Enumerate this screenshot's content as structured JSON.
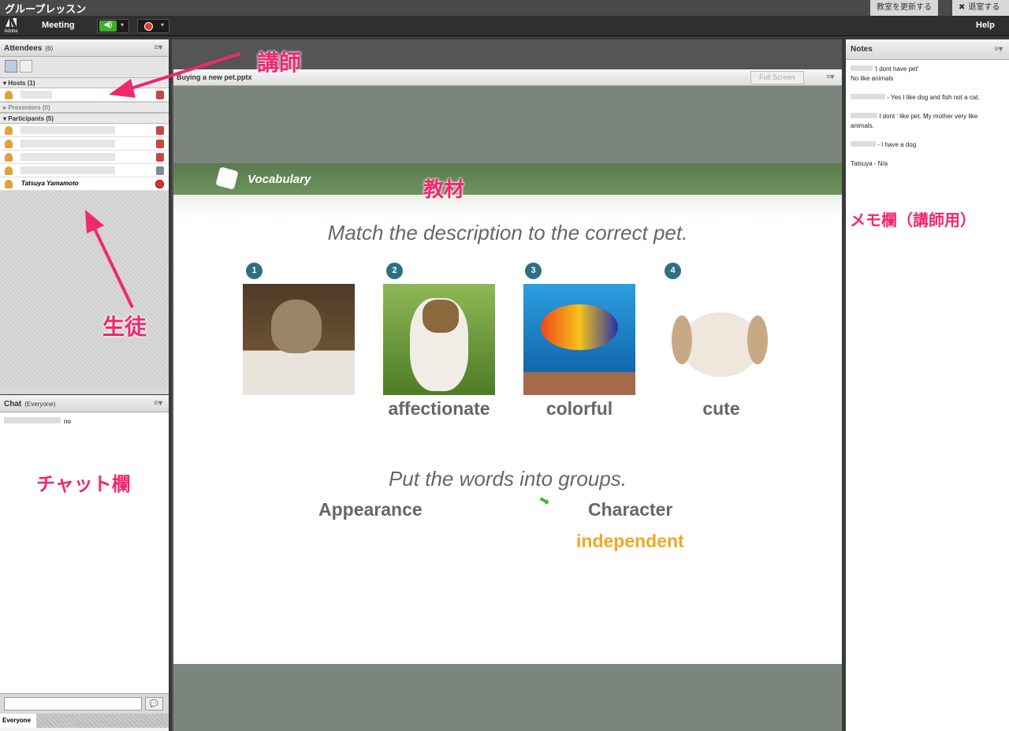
{
  "app": {
    "window_title": "グループレッスン",
    "update_room": "教室を更新する",
    "leave_room": "退室する",
    "menu_meeting": "Meeting",
    "menu_help": "Help",
    "adobe_label": "Adobe"
  },
  "attendees": {
    "title": "Attendees",
    "count": "(6)",
    "hosts_label": "Hosts (1)",
    "presenters_label": "Presenters (0)",
    "participants_label": "Participants (5)",
    "named_participant": "Tatsuya Yamamoto"
  },
  "chat": {
    "title": "Chat",
    "scope": "(Everyone)",
    "message_text": "no",
    "tab": "Everyone"
  },
  "share": {
    "filename": "Buying a new pet.pptx",
    "fullscreen": "Full Screen"
  },
  "slide": {
    "header": "Vocabulary",
    "instruction1": "Match the description to the correct pet.",
    "numbers": [
      "1",
      "2",
      "3",
      "4"
    ],
    "words": [
      "affectionate",
      "colorful",
      "cute"
    ],
    "instruction2": "Put the words into groups.",
    "group_left": "Appearance",
    "group_right": "Character",
    "dragged_word": "independent",
    "accent_color": "#f5a623"
  },
  "notes": {
    "title": "Notes",
    "lines": [
      "'I dont have pet'",
      "No like animals",
      "- Yes I like dog and fish not a cat.",
      "I dont ' like pet. My mother very like",
      "animals.",
      "- I have a dog",
      "Tatsuya - N/a"
    ]
  },
  "annotations": {
    "teacher": "講師",
    "material": "教材",
    "memo": "メモ欄（講師用）",
    "students": "生徒",
    "chat": "チャット欄"
  }
}
